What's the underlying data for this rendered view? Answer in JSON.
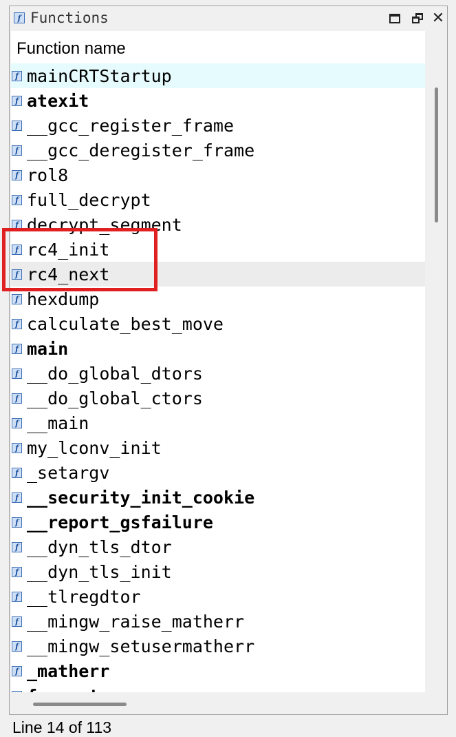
{
  "window": {
    "title": "Functions",
    "title_icon": "function-icon",
    "buttons": {
      "maximize_icon": "maximize-icon",
      "restore_icon": "restore-icon",
      "close_icon": "close-icon",
      "close_glyph": "✕"
    }
  },
  "table": {
    "column_header": "Function name",
    "rows": [
      {
        "name": "mainCRTStartup",
        "bold": false,
        "state": "selected"
      },
      {
        "name": "atexit",
        "bold": true,
        "state": ""
      },
      {
        "name": "__gcc_register_frame",
        "bold": false,
        "state": ""
      },
      {
        "name": "__gcc_deregister_frame",
        "bold": false,
        "state": ""
      },
      {
        "name": "rol8",
        "bold": false,
        "state": ""
      },
      {
        "name": "full_decrypt",
        "bold": false,
        "state": ""
      },
      {
        "name": "decrypt_segment",
        "bold": false,
        "state": ""
      },
      {
        "name": "rc4_init",
        "bold": false,
        "state": ""
      },
      {
        "name": "rc4_next",
        "bold": false,
        "state": "hovered"
      },
      {
        "name": "hexdump",
        "bold": false,
        "state": ""
      },
      {
        "name": "calculate_best_move",
        "bold": false,
        "state": ""
      },
      {
        "name": "main",
        "bold": true,
        "state": ""
      },
      {
        "name": "__do_global_dtors",
        "bold": false,
        "state": ""
      },
      {
        "name": "__do_global_ctors",
        "bold": false,
        "state": ""
      },
      {
        "name": "__main",
        "bold": false,
        "state": ""
      },
      {
        "name": "my_lconv_init",
        "bold": false,
        "state": ""
      },
      {
        "name": "_setargv",
        "bold": false,
        "state": ""
      },
      {
        "name": "__security_init_cookie",
        "bold": true,
        "state": ""
      },
      {
        "name": "__report_gsfailure",
        "bold": true,
        "state": ""
      },
      {
        "name": "__dyn_tls_dtor",
        "bold": false,
        "state": ""
      },
      {
        "name": "__dyn_tls_init",
        "bold": false,
        "state": ""
      },
      {
        "name": "__tlregdtor",
        "bold": false,
        "state": ""
      },
      {
        "name": "__mingw_raise_matherr",
        "bold": false,
        "state": ""
      },
      {
        "name": "__mingw_setusermatherr",
        "bold": false,
        "state": ""
      },
      {
        "name": "_matherr",
        "bold": true,
        "state": ""
      },
      {
        "name": "fpreset",
        "bold": true,
        "state": ""
      }
    ]
  },
  "colors": {
    "selected_row": "#e6fbfd",
    "hovered_row": "#ececec",
    "highlight_box": "#e02020"
  },
  "status": {
    "text": "Line 14 of 113"
  }
}
